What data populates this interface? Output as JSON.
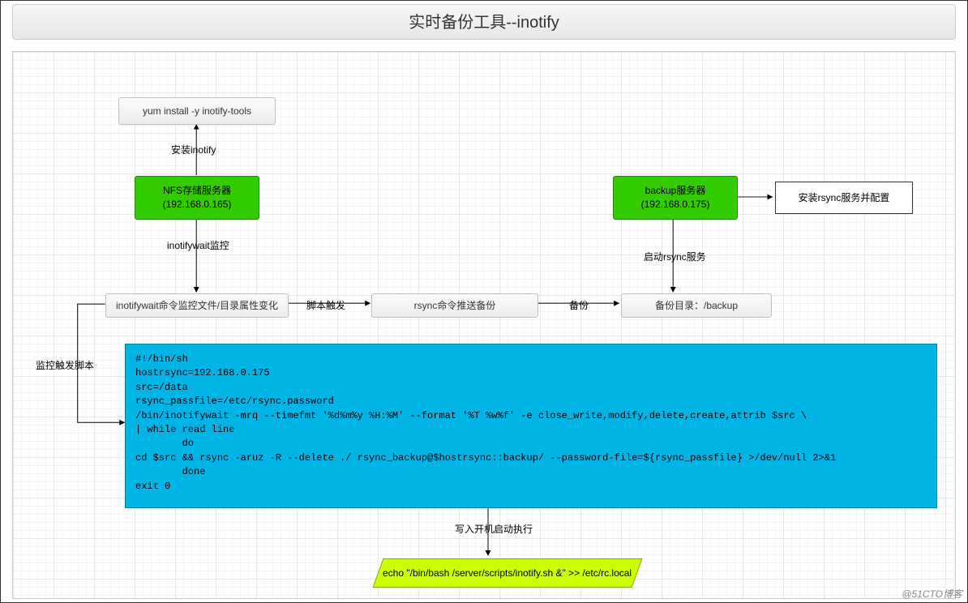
{
  "title": "实时备份工具--inotify",
  "nodes": {
    "yum": "yum install -y inotify-tools",
    "nfs_line1": "NFS存储服务器",
    "nfs_line2": "(192.168.0.165)",
    "inotifywait_monitor": "inotifywait命令监控文件/目录属性变化",
    "rsync_push": "rsync命令推送备份",
    "backup_line1": "backup服务器",
    "backup_line2": "(192.168.0.175)",
    "install_rsync": "安装rsync服务并配置",
    "backup_dir": "备份目录：/backup",
    "echo_cmd": "echo \"/bin/bash /server/scripts/inotify.sh &\" >> /etc/rc.local"
  },
  "labels": {
    "install_inotify": "安装inotify",
    "inotifywait_watch": "inotifywait监控",
    "script_trigger": "脚本触发",
    "backup": "备份",
    "start_rsync": "启动rsync服务",
    "monitor_trigger_script": "监控触发脚本",
    "write_boot": "写入开机启动执行"
  },
  "script": "#!/bin/sh\nhostrsync=192.168.0.175\nsrc=/data\nrsync_passfile=/etc/rsync.password\n/bin/inotifywait -mrq --timefmt '%d%m%y %H:%M' --format '%T %w%f' -e close_write,modify,delete,create,attrib $src \\\n| while read line\n        do\ncd $src && rsync -aruz -R --delete ./ rsync_backup@$hostrsync::backup/ --password-file=${rsync_passfile} >/dev/null 2>&1\n        done\nexit 0",
  "watermark": "@51CTO博客"
}
